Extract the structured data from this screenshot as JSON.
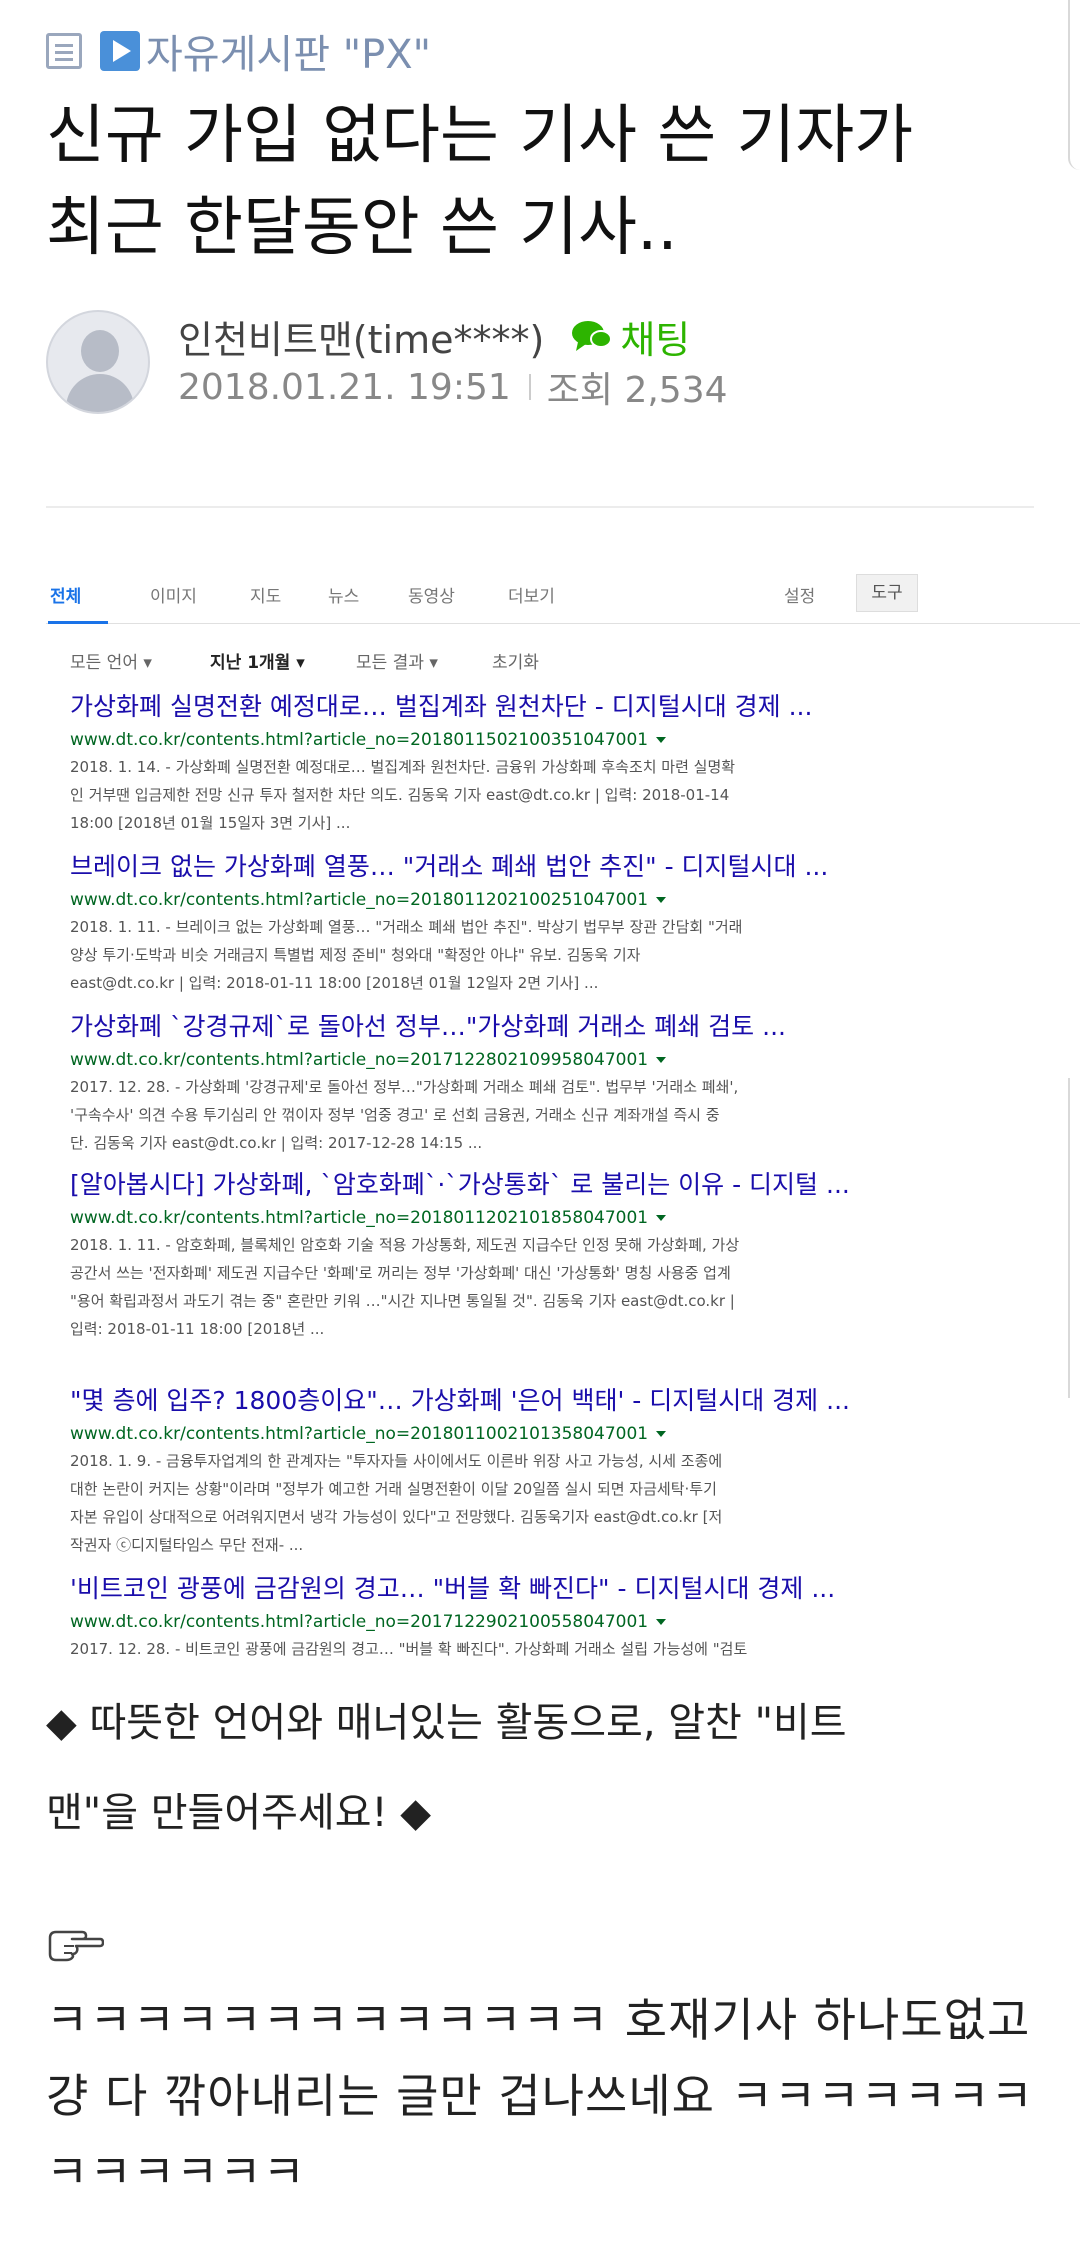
{
  "board": {
    "name": "자유게시판 \"PX\""
  },
  "post": {
    "title_line1": "신규 가입 없다는 기사 쓴 기자가",
    "title_line2": "최근 한달동안 쓴 기사..",
    "author": "인천비트맨(time****)",
    "chat_label": "채팅",
    "date": "2018.01.21. 19:51",
    "views": "조회 2,534"
  },
  "search": {
    "tabs": [
      "전체",
      "이미지",
      "지도",
      "뉴스",
      "동영상",
      "더보기"
    ],
    "settings": "설정",
    "tools": "도구",
    "filters": [
      "모든 언어 ▾",
      "지난 1개월 ▾",
      "모든 결과 ▾",
      "초기화"
    ],
    "results": [
      {
        "title": "가상화폐 실명전환 예정대로… 벌집계좌 원천차단 - 디지털시대 경제 ...",
        "url": "www.dt.co.kr/contents.html?article_no=2018011502100351047001",
        "snippet": [
          "2018. 1. 14. - 가상화폐 실명전환 예정대로… 벌집계좌 원천차단. 금융위 가상화폐 후속조치 마련 실명확",
          "인 거부땐 입금제한 전망 신규 투자 철저한 차단 의도. 김동욱 기자 east@dt.co.kr | 입력: 2018-01-14",
          "18:00 [2018년 01월 15일자 3면 기사] ..."
        ]
      },
      {
        "title": "브레이크 없는 가상화폐 열풍… \"거래소 폐쇄 법안 추진\" - 디지털시대 ...",
        "url": "www.dt.co.kr/contents.html?article_no=2018011202100251047001",
        "snippet": [
          "2018. 1. 11. - 브레이크 없는 가상화폐 열풍… \"거래소 폐쇄 법안 추진\". 박상기 법무부 장관 간담회 \"거래",
          "양상 투기·도박과 비슷 거래금지 특별법 제정 준비\" 청와대 \"확정안 아냐\" 유보. 김동욱 기자",
          "east@dt.co.kr | 입력: 2018-01-11 18:00 [2018년 01월 12일자 2면 기사] ..."
        ]
      },
      {
        "title": "가상화폐 `강경규제`로 돌아선 정부…\"가상화폐 거래소 폐쇄 검토 ...",
        "url": "www.dt.co.kr/contents.html?article_no=2017122802109958047001",
        "snippet": [
          "2017. 12. 28. - 가상화폐 '강경규제'로 돌아선 정부…\"가상화폐 거래소 폐쇄 검토\". 법무부 '거래소 폐쇄',",
          "'구속수사' 의견 수용 투기심리 안 꺾이자 정부 '엄중 경고' 로 선회 금융권, 거래소 신규 계좌개설 즉시 중",
          "단. 김동욱 기자 east@dt.co.kr | 입력: 2017-12-28 14:15 ..."
        ]
      },
      {
        "title": "[알아봅시다] 가상화폐, `암호화폐`·`가상통화` 로 불리는 이유 - 디지털 ...",
        "url": "www.dt.co.kr/contents.html?article_no=2018011202101858047001",
        "snippet": [
          "2018. 1. 11. - 암호화폐, 블록체인 암호화 기술 적용 가상통화, 제도권 지급수단 인정 못해 가상화폐, 가상",
          "공간서 쓰는 '전자화폐' 제도권 지급수단 '화폐'로 꺼리는 정부 '가상화폐' 대신 '가상통화' 명칭 사용중 업계",
          "\"용어 확립과정서 과도기 겪는 중\" 혼란만 키워 …\"시간 지나면 통일될 것\". 김동욱 기자 east@dt.co.kr |",
          "입력: 2018-01-11 18:00 [2018년 ..."
        ]
      },
      {
        "title": "\"몇 층에 입주? 1800층이요\"… 가상화폐 '은어 백태' - 디지털시대 경제 ...",
        "url": "www.dt.co.kr/contents.html?article_no=2018011002101358047001",
        "snippet": [
          "2018. 1. 9. - 금융투자업계의 한 관계자는 \"투자자들 사이에서도 이른바 위장 사고 가능성, 시세 조종에",
          "대한 논란이 커지는 상황\"이라며 \"정부가 예고한 거래 실명전환이 이달 20일쯤 실시 되면 자금세탁·투기",
          "자본 유입이 상대적으로 어려워지면서 냉각 가능성이 있다\"고 전망했다. 김동욱기자 east@dt.co.kr [저",
          "작권자 ⓒ디지털타임스 무단 전재- ..."
        ]
      },
      {
        "title": "'비트코인 광풍에 금감원의 경고… \"버블 확 빠진다\" - 디지털시대 경제 ...",
        "url": "www.dt.co.kr/contents.html?article_no=2017122902100558047001",
        "snippet": [
          "2017. 12. 28. - 비트코인 광풍에 금감원의 경고… \"버블 확 빠진다\". 가상화폐 거래소 설립 가능성에 \"검토"
        ]
      }
    ]
  },
  "notice": {
    "line1": "◆ 따뜻한 언어와 매너있는 활동으로, 알찬 \"비트",
    "line2": "맨\"을 만들어주세요! ◆"
  },
  "comment": {
    "line1": "ㅋㅋㅋㅋㅋㅋㅋㅋㅋㅋㅋㅋㅋ 호재기사 하나도없고",
    "line2": "걍 다 깎아내리는 글만 겁나쓰네요 ㅋㅋㅋㅋㅋㅋㅋ",
    "line3": "ㅋㅋㅋㅋㅋㅋ"
  }
}
